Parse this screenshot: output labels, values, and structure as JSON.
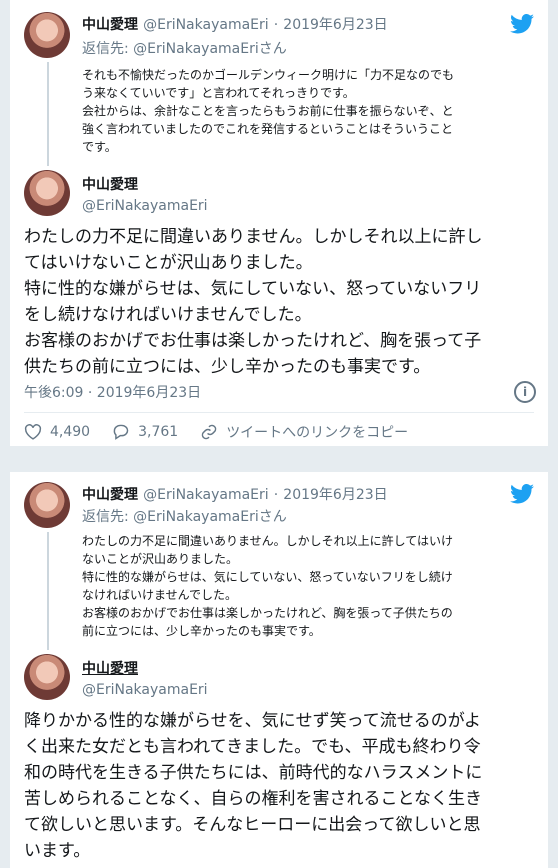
{
  "card1": {
    "top_tweet": {
      "name": "中山愛理",
      "handle": "@EriNakayamaEri",
      "separator": "·",
      "date": "2019年6月23日",
      "reply_to_label": "返信先:",
      "reply_to_handle": "@EriNakayamaEri",
      "reply_to_suffix": "さん",
      "lines": [
        "それも不愉快だったのかゴールデンウィーク明けに「力不足なのでも",
        "う来なくていいです」と言われてそれっきりです。",
        "会社からは、余計なことを言ったらもうお前に仕事を振らないぞ、と",
        "強く言われていましたのでこれを発信するということはそういうこと",
        "です。"
      ]
    },
    "main_tweet": {
      "name": "中山愛理",
      "handle": "@EriNakayamaEri",
      "lines": [
        "わたしの力不足に間違いありません。しかしそれ以上に許し",
        "てはいけないことが沢山ありました。",
        "特に性的な嫌がらせは、気にしていない、怒っていないフリ",
        "をし続けなければいけませんでした。",
        "お客様のおかげでお仕事は楽しかったけれど、胸を張って子",
        "供たちの前に立つには、少し辛かったのも事実です。"
      ],
      "timestamp": "午後6:09 · 2019年6月23日",
      "likes": "4,490",
      "replies": "3,761",
      "copy_link": "ツイートへのリンクをコピー"
    }
  },
  "card2": {
    "top_tweet": {
      "name": "中山愛理",
      "handle": "@EriNakayamaEri",
      "separator": "·",
      "date": "2019年6月23日",
      "reply_to_label": "返信先:",
      "reply_to_handle": "@EriNakayamaEri",
      "reply_to_suffix": "さん",
      "lines": [
        "わたしの力不足に間違いありません。しかしそれ以上に許してはいけ",
        "ないことが沢山ありました。",
        "特に性的な嫌がらせは、気にしていない、怒っていないフリをし続け",
        "なければいけませんでした。",
        "お客様のおかげでお仕事は楽しかったけれど、胸を張って子供たちの",
        "前に立つには、少し辛かったのも事実です。"
      ]
    },
    "main_tweet": {
      "name": "中山愛理",
      "handle": "@EriNakayamaEri",
      "lines": [
        "降りかかる性的な嫌がらせを、気にせず笑って流せるのがよ",
        "く出来た女だとも言われてきました。でも、平成も終わり令",
        "和の時代を生きる子供たちには、前時代的なハラスメントに",
        "苦しめられることなく、自らの権利を害されることなく生き",
        "て欲しいと思います。そんなヒーローに出会って欲しいと思",
        "います。"
      ]
    }
  },
  "colors": {
    "twitter_blue": "#1da1f2",
    "secondary_text": "#657786",
    "background": "#e6ecf0"
  },
  "icons": [
    "twitter-bird-icon",
    "heart-icon",
    "reply-bubble-icon",
    "link-icon",
    "info-icon"
  ]
}
